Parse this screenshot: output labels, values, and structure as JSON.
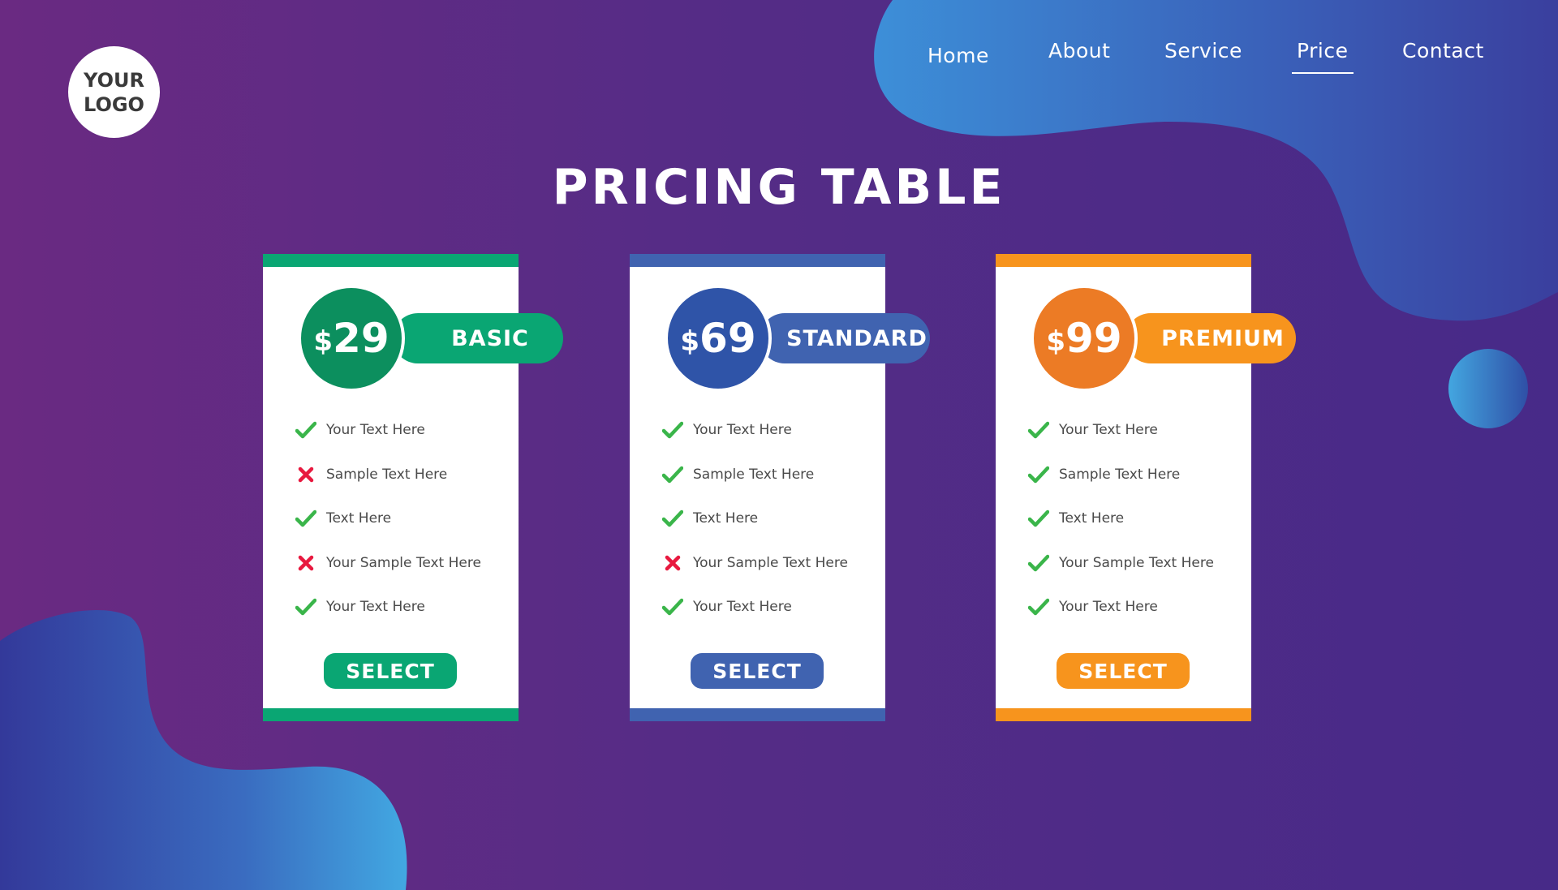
{
  "logo": {
    "line1": "YOUR",
    "line2": "LOGO"
  },
  "nav": {
    "items": [
      "Home",
      "About",
      "Service",
      "Price",
      "Contact"
    ],
    "active": "Price"
  },
  "page_title": "PRICING TABLE",
  "plans": [
    {
      "currency": "$",
      "price": "29",
      "name": "BASIC",
      "color": "#0aa673",
      "circle_color": "#0c8f5e",
      "features": [
        {
          "text": "Your Text Here",
          "included": true
        },
        {
          "text": "Sample Text Here",
          "included": false
        },
        {
          "text": "Text Here",
          "included": true
        },
        {
          "text": "Your Sample Text Here",
          "included": false
        },
        {
          "text": "Your Text Here",
          "included": true
        }
      ],
      "button": "SELECT"
    },
    {
      "currency": "$",
      "price": "69",
      "name": "STANDARD",
      "color": "#4063b0",
      "circle_color": "#2f54a8",
      "features": [
        {
          "text": "Your Text Here",
          "included": true
        },
        {
          "text": "Sample Text Here",
          "included": true
        },
        {
          "text": "Text Here",
          "included": true
        },
        {
          "text": "Your Sample Text Here",
          "included": false
        },
        {
          "text": "Your Text Here",
          "included": true
        }
      ],
      "button": "SELECT"
    },
    {
      "currency": "$",
      "price": "99",
      "name": "PREMIUM",
      "color": "#f7941d",
      "circle_color": "#ec7b25",
      "features": [
        {
          "text": "Your Text Here",
          "included": true
        },
        {
          "text": "Sample Text Here",
          "included": true
        },
        {
          "text": "Text Here",
          "included": true
        },
        {
          "text": "Your Sample Text Here",
          "included": true
        },
        {
          "text": "Your Text Here",
          "included": true
        }
      ],
      "button": "SELECT"
    }
  ],
  "colors": {
    "check": "#3ab54a",
    "cross": "#e8193f"
  }
}
